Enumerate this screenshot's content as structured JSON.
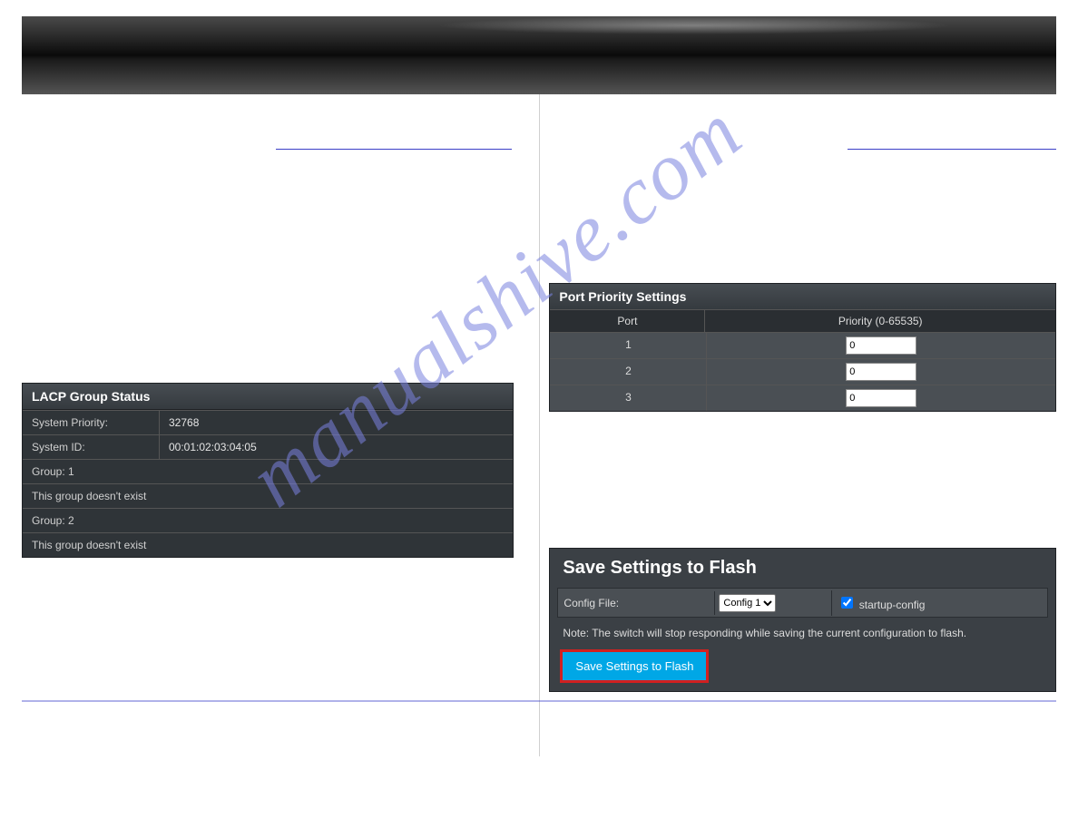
{
  "watermark_text": "manualshive.com",
  "left": {
    "top_link": " ",
    "lacp_title": "LACP Group Status",
    "system_priority_label": "System Priority:",
    "system_priority_value": "32768",
    "system_id_label": "System ID:",
    "system_id_value": "00:01:02:03:04:05",
    "group1_label": "Group: 1",
    "group1_status": "This group doesn't exist",
    "group2_label": "Group: 2",
    "group2_status": "This group doesn't exist"
  },
  "right": {
    "top_link": " ",
    "port_title": "Port Priority Settings",
    "col_port": "Port",
    "col_priority": "Priority (0-65535)",
    "rows": [
      {
        "port": "1",
        "value": "0"
      },
      {
        "port": "2",
        "value": "0"
      },
      {
        "port": "3",
        "value": "0"
      }
    ],
    "save_title": "Save Settings to Flash",
    "config_label": "Config File:",
    "config_value": "Config 1",
    "startup_label": "startup-config",
    "note": "Note: The switch will stop responding while saving the current configuration to flash.",
    "save_button": "Save Settings to Flash"
  }
}
